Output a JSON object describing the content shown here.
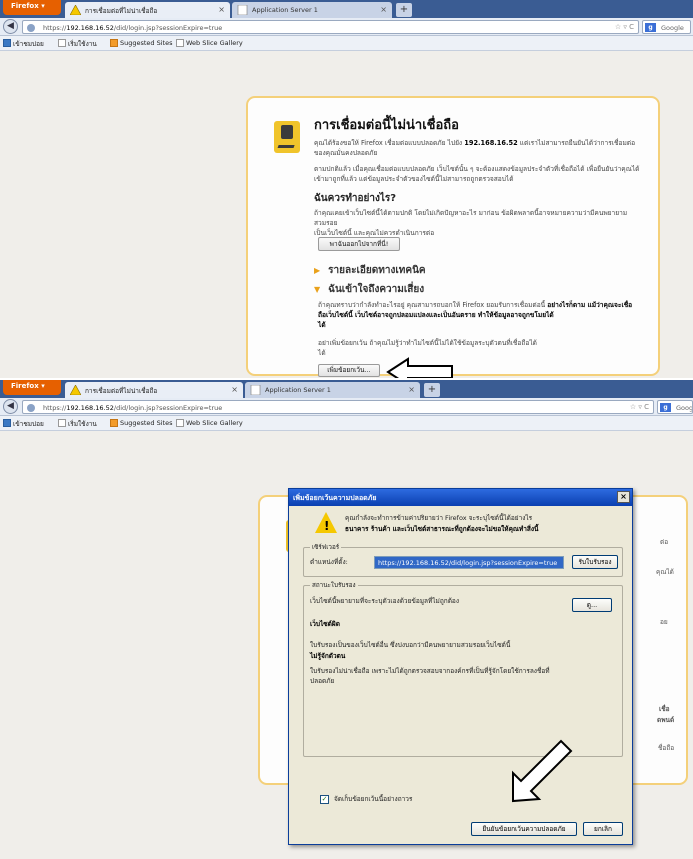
{
  "browser": {
    "menu_button": "Firefox",
    "tab_active_title": "การเชื่อมต่อที่ไม่น่าเชื่อถือ",
    "tab_inactive_title": "Application Server 1",
    "new_tab": "+",
    "tab_close": "×",
    "url_prefix": "https://",
    "url_host": "192.168.16.52",
    "url_path": "/did/login.jsp?sessionExpire=true",
    "search_engine": "Google",
    "bookmarks": [
      "เข้าชมบ่อย",
      "เริ่มใช้งาน",
      "Suggested Sites",
      "Web Slice Gallery"
    ]
  },
  "error_page": {
    "title": "การเชื่อมต่อนี้ไม่น่าเชื่อถือ",
    "intro_line1_a": "คุณได้ร้องขอให้ Firefox เชื่อมต่อแบบปลอดภัย ไปยัง",
    "intro_host": "192.168.16.52",
    "intro_line1_b": "แต่เราไม่สามารถยืนยันได้ว่าการเชื่อมต่อ",
    "intro_line2": "ของคุณมั่นคงปลอดภัย",
    "para2_line1": "ตามปกติแล้ว เมื่อคุณเชื่อมต่อแบบปลอดภัย เว็บไซต์นั้น ๆ จะต้องแสดงข้อมูลประจำตัวที่เชื่อถือได้ เพื่อยืนยันว่าคุณได้",
    "para2_line2": "เข้ามาถูกที่แล้ว แต่ข้อมูลประจำตัวของไซต์นี้ไม่สามารถถูกตรวจสอบได้",
    "what_heading": "ฉันควรทำอย่างไร?",
    "what_line1": "ถ้าคุณเคยเข้าเว็บไซต์นี้ได้ตามปกติ โดยไม่เกิดปัญหาอะไร มาก่อน ข้อผิดพลาดนี้อาจหมายความว่ามีคนพยายามสวมรอย",
    "what_line2": "เป็นเว็บไซต์นี้ และคุณไม่ควรดำเนินการต่อ",
    "get_me_out": "พาฉันออกไปจากที่นี่!",
    "technical_details": "รายละเอียดทางเทคนิค",
    "understand_risks": "ฉันเข้าใจถึงความเสี่ยง",
    "risk_line1": "ถ้าคุณทราบว่ากำลังทำอะไรอยู่ คุณสามารถบอกให้ Firefox ยอมรับการเชื่อมต่อนี้",
    "risk_line1_bold": "อย่างไรก็ตาม แม้ว่าคุณจะเชื่อ",
    "risk_line2_bold": "ถือเว็บไซต์นี้ เว็บไซต์อาจถูกปลอมแปลงและเป็นอันตราย ทำให้ข้อมูลอาจถูกขโมยได้",
    "risk_line3_bold": "ได้",
    "risk_line4": "อย่าเพิ่มข้อยกเว้น ถ้าคุณไม่รู้ว่าทำไมไซต์นี้ไม่ได้ใช้ข้อมูลระบุตัวตนที่เชื่อถือได้",
    "risk_line5": "ได้",
    "add_exception": "เพิ่มข้อยกเว้น...",
    "partial_right": [
      "ต่อ",
      "คุณได้",
      "อย",
      "เชื่อ",
      "ดพนด์",
      "ชื่อถือ"
    ]
  },
  "dialog": {
    "title": "เพิ่มข้อยกเว้นความปลอดภัย",
    "close": "×",
    "warn_line1": "คุณกำลังจะทำการข้ามค่าปริยายว่า Firefox จะระบุไซต์นี้ได้อย่างไร",
    "warn_line2_bold": "ธนาคาร ร้านค้า และเว็บไซต์สาธารณะที่ถูกต้องจะไม่ขอให้คุณทำสิ่งนี้",
    "server_group": "เซิร์ฟเวอร์",
    "location_label": "ตำแหน่งที่ตั้ง:",
    "location_value": "https://192.168.16.52/did/login.jsp?sessionExpire=true",
    "get_certificate": "รับใบรับรอง",
    "status_group": "สถานะใบรับรอง",
    "status_line": "เว็บไซต์นี้พยายามที่จะระบุตัวเองด้วยข้อมูลที่ไม่ถูกต้อง",
    "view_button": "ดู...",
    "wrong_site": "เว็บไซต์ผิด",
    "cert_other_line": "ใบรับรองเป็นของเว็บไซต์อื่น ซึ่งบ่งบอกว่ามีคนพยายามสวมรอยเว็บไซต์นี้",
    "unknown_identity": "ไม่รู้จักตัวตน",
    "untrusted_line1": "ใบรับรองไม่น่าเชื่อถือ เพราะไม่ได้ถูกตรวจสอบจากองค์กรที่เป็นที่รู้จักโดยใช้การลงชื่อที่",
    "untrusted_line2": "ปลอดภัย",
    "perm_store": "จัดเก็บข้อยกเว้นนี้อย่างถาวร",
    "confirm_button": "ยืนยันข้อยกเว้นความปลอดภัย",
    "cancel_button": "ยกเลิก"
  },
  "colors": {
    "tabbar": "#3a5c93",
    "firefox_orange": "#e66000",
    "card_border": "#f4d07a",
    "dialog_title": "#0a3fb0"
  }
}
